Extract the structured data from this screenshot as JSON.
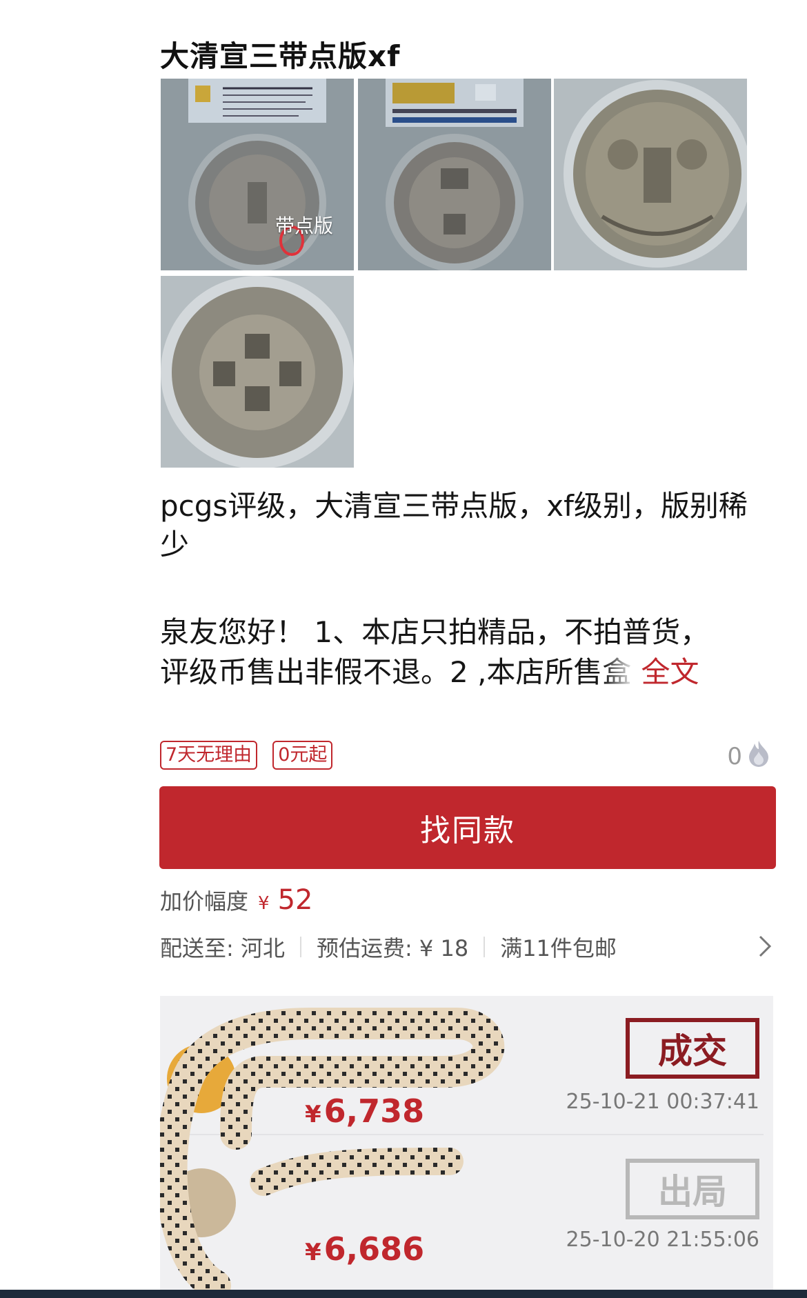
{
  "product": {
    "title": "大清宣三带点版xf",
    "thumb_overlay": "带点版",
    "description": "pcgs评级，大清宣三带点版，xf级别，版别稀少",
    "intro_line1": "泉友您好！ 1、本店只拍精品，不拍普货，",
    "intro_line2": "评级币售出非假不退。2 ,本店所售盒",
    "fulltext_label": "全文"
  },
  "tags": [
    "7天无理由",
    "0元起"
  ],
  "likes": {
    "count": "0",
    "icon": "flame-icon"
  },
  "find_same_button": "找同款",
  "markup": {
    "label": "加价幅度",
    "currency": "¥",
    "amount": "52"
  },
  "shipping": {
    "deliver_to": "配送至: 河北",
    "estimated_fee": "预估运费: ¥ 18",
    "free_shipping": "满11件包邮",
    "chevron_icon": "chevron-right-icon"
  },
  "records": [
    {
      "currency": "¥",
      "price": "6,738",
      "time": "25-10-21 00:37:41",
      "stamp": "成交"
    },
    {
      "currency": "¥",
      "price": "6,686",
      "time": "25-10-20 21:55:06",
      "stamp": "出局"
    }
  ],
  "colors": {
    "accent": "#c0272d",
    "deal_stamp": "#8b1c22",
    "out_stamp": "#b8b8b8"
  }
}
